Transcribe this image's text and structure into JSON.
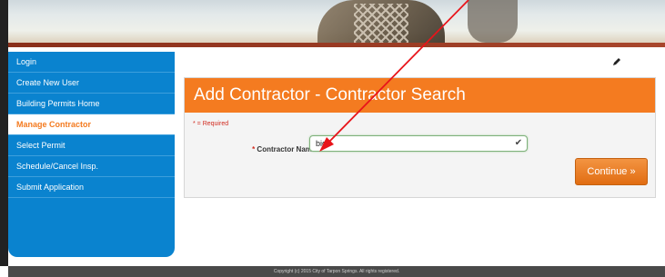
{
  "sidebar": {
    "items": [
      {
        "label": "Login",
        "active": false
      },
      {
        "label": "Create New User",
        "active": false
      },
      {
        "label": "Building Permits Home",
        "active": false
      },
      {
        "label": "Manage Contractor",
        "active": true
      },
      {
        "label": "Select Permit",
        "active": false
      },
      {
        "label": "Schedule/Cancel Insp.",
        "active": false
      },
      {
        "label": "Submit Application",
        "active": false
      }
    ]
  },
  "page": {
    "title": "Add Contractor - Contractor Search",
    "required_note": "* = Required",
    "edit_icon": "pencil-icon"
  },
  "form": {
    "contractor_label": "Contractor Name:",
    "required_marker": "*",
    "contractor_value": "big",
    "valid_icon": "checkmark-icon"
  },
  "actions": {
    "continue_label": "Continue »"
  },
  "footer": {
    "text": "Copyright (c) 2015 City of Tarpon Springs. All rights registered."
  },
  "colors": {
    "accent_orange": "#f47b20",
    "sidebar_blue": "#0a83cf",
    "annotation_red": "#e8141a"
  }
}
